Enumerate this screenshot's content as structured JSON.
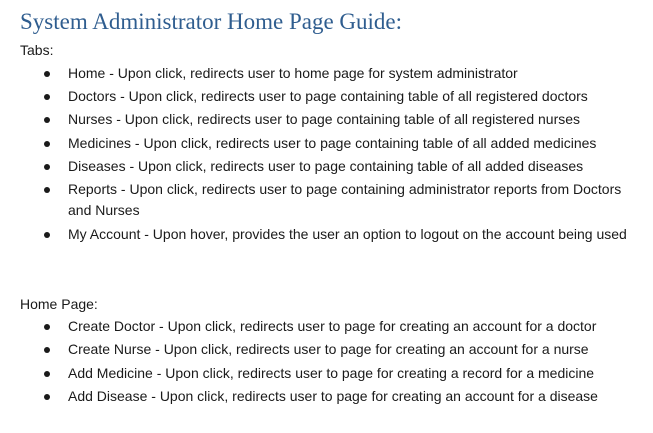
{
  "document": {
    "title": "System Administrator Home Page Guide:",
    "tabs_label": "Tabs:",
    "tabs": [
      "Home - Upon click, redirects user to home page for system administrator",
      "Doctors - Upon click, redirects user to page containing table of all registered doctors",
      "Nurses - Upon click, redirects user to page containing table of all registered nurses",
      "Medicines - Upon click, redirects user to page containing table of all added medicines",
      "Diseases - Upon click, redirects user to page containing table of all added diseases",
      "Reports - Upon click, redirects user to page containing administrator reports from Doctors and Nurses",
      "My Account - Upon hover, provides the user an option to logout on the account being used"
    ],
    "home_label": "Home Page:",
    "home_items": [
      "Create Doctor - Upon click, redirects user to page for creating an account for a doctor",
      "Create Nurse - Upon click, redirects user to page for creating an account for a nurse",
      "Add Medicine - Upon click, redirects user to page for creating a record for a medicine",
      "Add Disease - Upon click, redirects user to page for creating an account for a disease"
    ]
  }
}
